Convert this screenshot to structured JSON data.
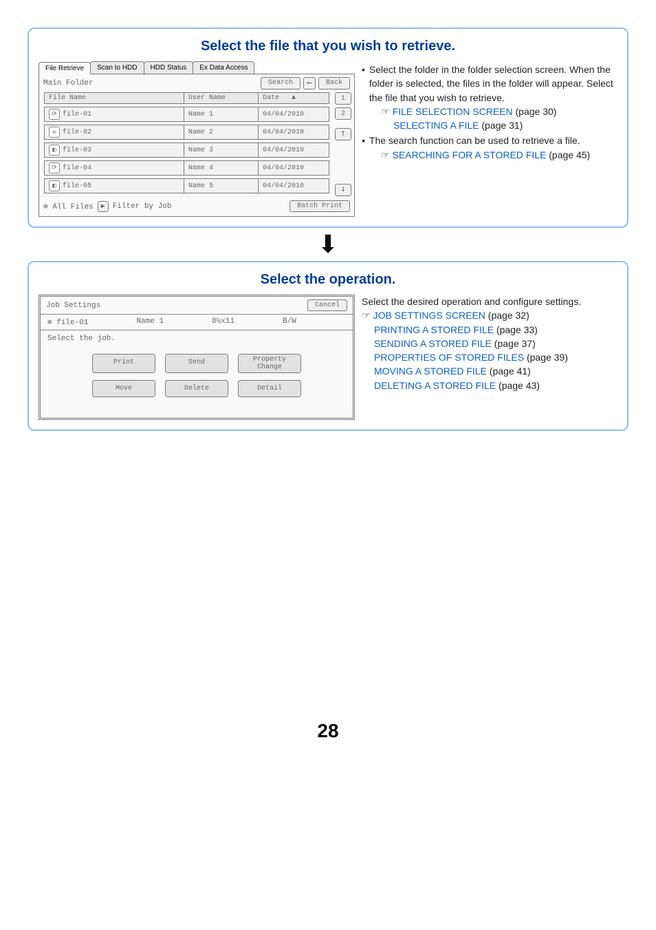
{
  "panel1": {
    "title": "Select the file that you wish to retrieve.",
    "screen": {
      "tabs": [
        "File Retrieve",
        "Scan to HDD",
        "HDD Status",
        "Ex Data Access"
      ],
      "folder": "Main Folder",
      "search": "Search",
      "back": "Back",
      "headers": {
        "file": "File Name",
        "user": "User Name",
        "date": "Date"
      },
      "rows": [
        {
          "icon": "⟳",
          "file": "file-01",
          "user": "Name 1",
          "date": "04/04/2010"
        },
        {
          "icon": "✉",
          "file": "file-02",
          "user": "Name 2",
          "date": "04/04/2010"
        },
        {
          "icon": "◧",
          "file": "file-03",
          "user": "Name 3",
          "date": "04/04/2010"
        },
        {
          "icon": "⟳",
          "file": "file-04",
          "user": "Name 4",
          "date": "04/04/2010"
        },
        {
          "icon": "◧",
          "file": "file-05",
          "user": "Name 5",
          "date": "04/04/2010"
        }
      ],
      "side": {
        "p1": "1",
        "p2": "2",
        "up": "⭡",
        "down": "⭣"
      },
      "footer": {
        "all": "All Files",
        "filter": "Filter by Job",
        "batch": "Batch Print"
      }
    },
    "desc": {
      "b1a": "Select the folder in the folder selection screen. When the folder is selected, the files in the folder will appear. Select the file that you wish to retrieve.",
      "link1": "FILE SELECTION SCREEN",
      "link1p": " (page 30)",
      "link2": "SELECTING A FILE",
      "link2p": " (page 31)",
      "b2a": "The search function can be used to retrieve a file.",
      "link3": "SEARCHING FOR A STORED FILE",
      "link3p": " (page 45)"
    }
  },
  "panel2": {
    "title": "Select the operation.",
    "screen": {
      "header": "Job Settings",
      "cancel": "Cancel",
      "file": "file-01",
      "name": "Name 1",
      "size": "8½x11",
      "color": "B/W",
      "label": "Select the job.",
      "btns": {
        "print": "Print",
        "send": "Send",
        "prop1": "Property",
        "prop2": "Change",
        "move": "Move",
        "delete": "Delete",
        "detail": "Detail"
      }
    },
    "desc": {
      "intro": "Select the desired operation and configure settings.",
      "links": [
        {
          "text": "JOB SETTINGS SCREEN",
          "page": " (page 32)"
        },
        {
          "text": "PRINTING A STORED FILE",
          "page": " (page 33)"
        },
        {
          "text": "SENDING A STORED FILE",
          "page": " (page 37)"
        },
        {
          "text": "PROPERTIES OF STORED FILES",
          "page": " (page 39)"
        },
        {
          "text": "MOVING A STORED FILE",
          "page": " (page 41)"
        },
        {
          "text": "DELETING A STORED FILE",
          "page": " (page 43)"
        }
      ]
    }
  },
  "pageno": "28"
}
